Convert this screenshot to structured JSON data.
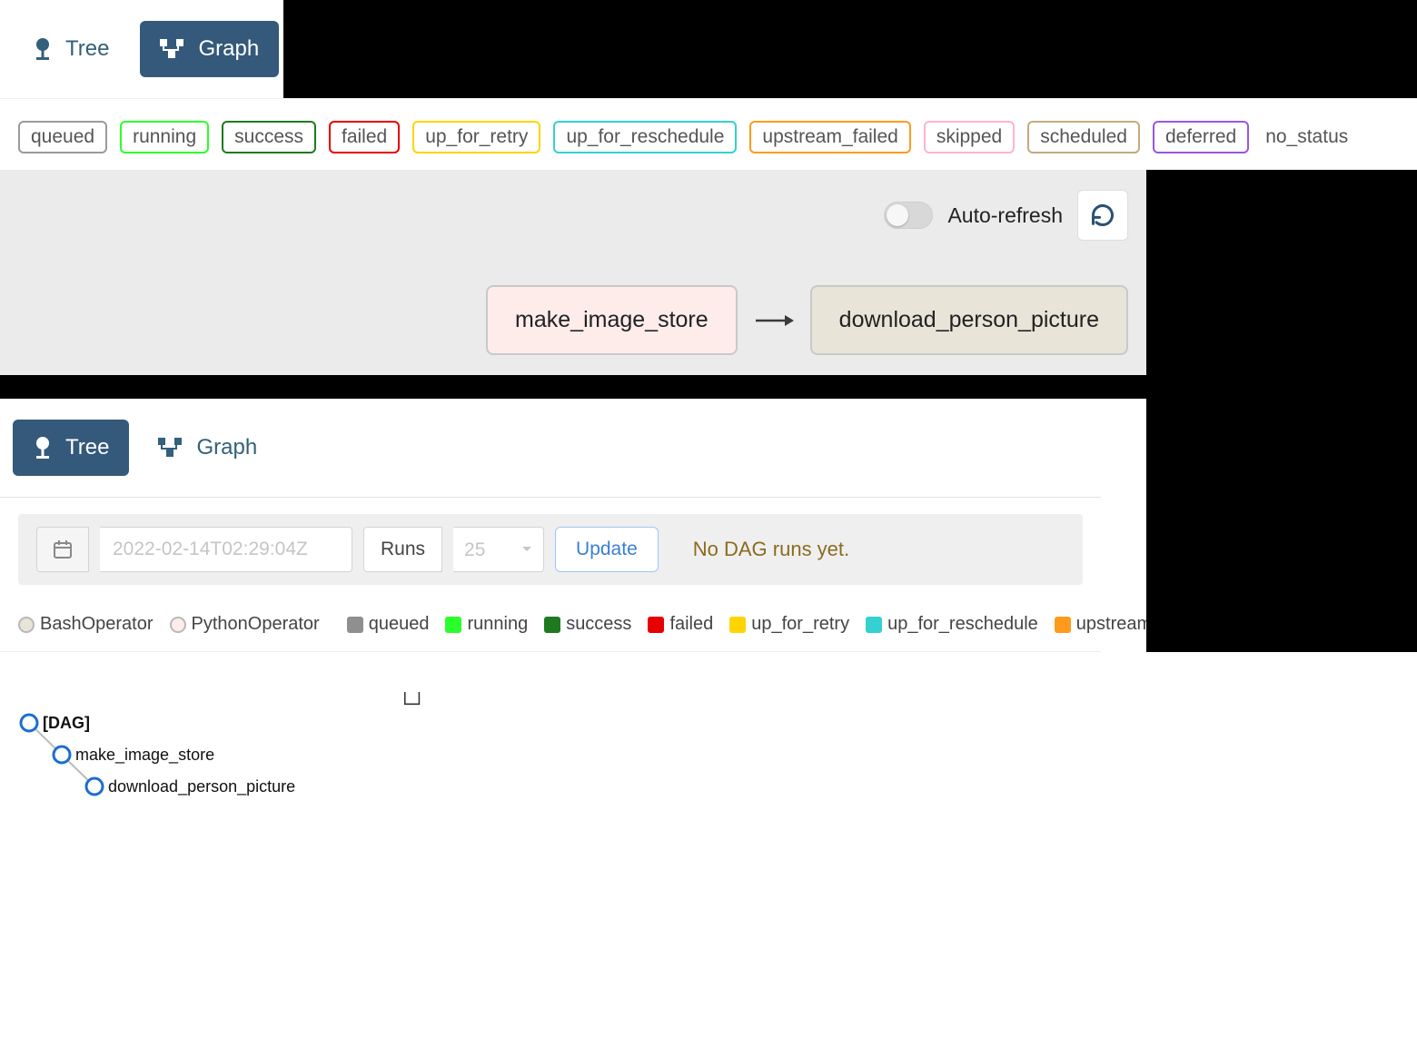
{
  "tabs": {
    "tree": "Tree",
    "graph": "Graph"
  },
  "status_pills": {
    "queued": "queued",
    "running": "running",
    "success": "success",
    "failed": "failed",
    "retry": "up_for_retry",
    "resched": "up_for_reschedule",
    "upfail": "upstream_failed",
    "skipped": "skipped",
    "scheduled": "scheduled",
    "deferred": "deferred",
    "nostatus": "no_status"
  },
  "autorefresh_label": "Auto-refresh",
  "graph_nodes": {
    "n1": "make_image_store",
    "n2": "download_person_picture"
  },
  "runbar": {
    "date_value": "2022-02-14T02:29:04Z",
    "runs_label": "Runs",
    "runs_value": "25",
    "update": "Update",
    "nodag": "No DAG runs yet."
  },
  "legend2": {
    "bash": "BashOperator",
    "python": "PythonOperator",
    "queued": "queued",
    "running": "running",
    "success": "success",
    "failed": "failed",
    "retry": "up_for_retry",
    "resched": "up_for_reschedule",
    "upfail": "upstream_failed"
  },
  "tree": {
    "root": "[DAG]",
    "n1": "make_image_store",
    "n2": "download_person_picture"
  }
}
